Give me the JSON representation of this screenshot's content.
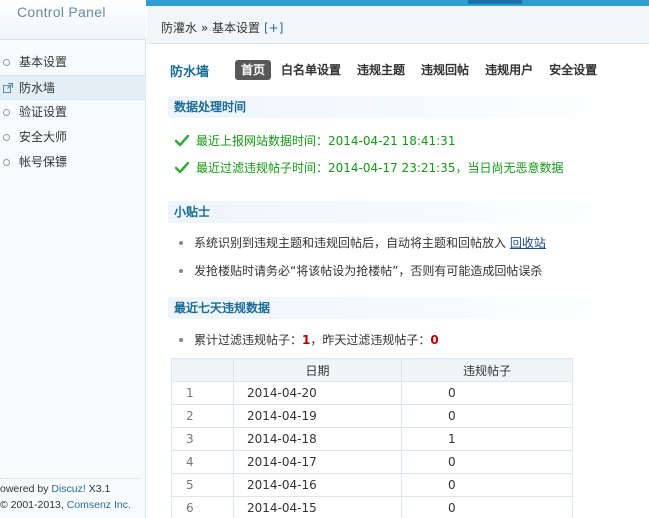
{
  "sidebar": {
    "title": "Control Panel",
    "items": [
      {
        "label": "基本设置"
      },
      {
        "label": "防水墙"
      },
      {
        "label": "验证设置"
      },
      {
        "label": "安全大师"
      },
      {
        "label": "帐号保镖"
      }
    ],
    "footer": {
      "powered_prefix": "owered by ",
      "powered_brand": "Discuz!",
      "powered_version": " X3.1",
      "copyright_prefix": "© 2001-2013, ",
      "copyright_company": "Comsenz Inc."
    }
  },
  "breadcrumb": {
    "text": "防灌水 » 基本设置",
    "plus": "[+]"
  },
  "page": {
    "title": "防水墙",
    "tabs": [
      {
        "label": "首页",
        "current": true
      },
      {
        "label": "白名单设置"
      },
      {
        "label": "违规主题"
      },
      {
        "label": "违规回帖"
      },
      {
        "label": "违规用户"
      },
      {
        "label": "安全设置"
      }
    ]
  },
  "data_time": {
    "heading": "数据处理时间",
    "line1": "最近上报网站数据时间：2014-04-21 18:41:31",
    "line2": "最近过滤违规帖子时间：2014-04-17 23:21:35，当日尚无恶意数据"
  },
  "tips": {
    "heading": "小贴士",
    "tip1_text": "系统识别到违规主题和违规回帖后，自动将主题和回帖放入 ",
    "tip1_link": "回收站",
    "tip2_text": "发抢楼贴时请务必“将该帖设为抢楼帖”，否则有可能造成回帖误杀"
  },
  "last7": {
    "heading": "最近七天违规数据",
    "summary_a": "累计过滤违规帖子：",
    "total": "1",
    "summary_b": "，昨天过滤违规帖子：",
    "yesterday": "0",
    "columns": [
      "",
      "日期",
      "违规帖子"
    ],
    "rows": [
      {
        "idx": "1",
        "date": "2014-04-20",
        "count": "0"
      },
      {
        "idx": "2",
        "date": "2014-04-19",
        "count": "0"
      },
      {
        "idx": "3",
        "date": "2014-04-18",
        "count": "1"
      },
      {
        "idx": "4",
        "date": "2014-04-17",
        "count": "0"
      },
      {
        "idx": "5",
        "date": "2014-04-16",
        "count": "0"
      },
      {
        "idx": "6",
        "date": "2014-04-15",
        "count": "0"
      }
    ]
  },
  "colors": {
    "accent": "#2f9fd3",
    "heading": "#1a6b96",
    "ok_text": "#139a13",
    "alert": "#c00000"
  }
}
